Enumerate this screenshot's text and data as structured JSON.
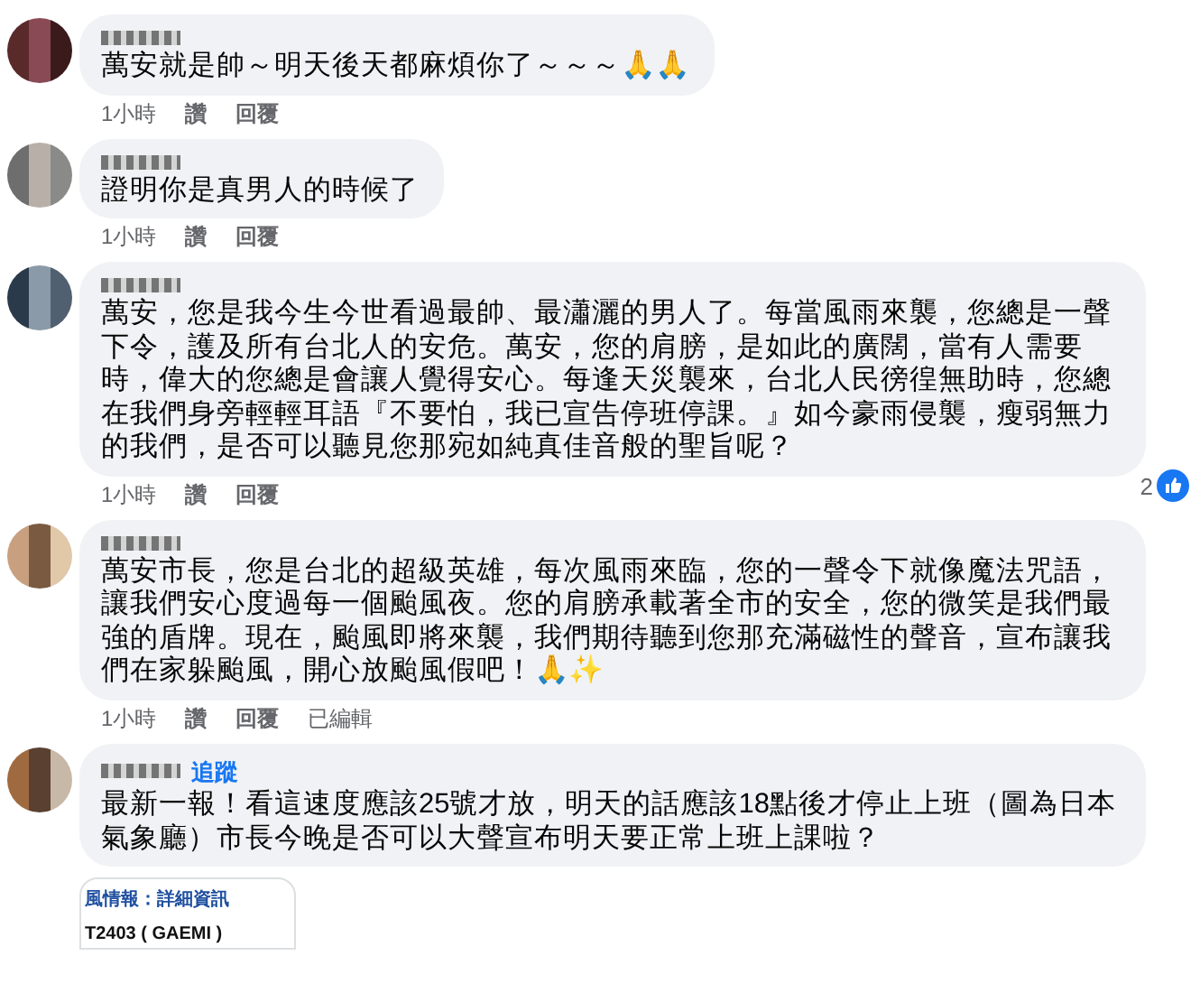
{
  "comments": [
    {
      "text": "萬安就是帥～明天後天都麻煩你了～～～🙏🙏",
      "actions": [
        {
          "label": "1小時",
          "kind": "time"
        },
        {
          "label": "讚",
          "kind": "link"
        },
        {
          "label": "回覆",
          "kind": "link"
        }
      ]
    },
    {
      "text": "證明你是真男人的時候了",
      "actions": [
        {
          "label": "1小時",
          "kind": "time"
        },
        {
          "label": "讚",
          "kind": "link"
        },
        {
          "label": "回覆",
          "kind": "link"
        }
      ]
    },
    {
      "text": "萬安，您是我今生今世看過最帥、最瀟灑的男人了。每當風雨來襲，您總是一聲下令，護及所有台北人的安危。萬安，您的肩膀，是如此的廣闊，當有人需要時，偉大的您總是會讓人覺得安心。每逢天災襲來，台北人民徬徨無助時，您總在我們身旁輕輕耳語『不要怕，我已宣告停班停課。』如今豪雨侵襲，瘦弱無力的我們，是否可以聽見您那宛如純真佳音般的聖旨呢？",
      "actions": [
        {
          "label": "1小時",
          "kind": "time"
        },
        {
          "label": "讚",
          "kind": "link"
        },
        {
          "label": "回覆",
          "kind": "link"
        }
      ],
      "reaction_count": "2"
    },
    {
      "text": "萬安市長，您是台北的超級英雄，每次風雨來臨，您的一聲令下就像魔法咒語，讓我們安心度過每一個颱風夜。您的肩膀承載著全市的安全，您的微笑是我們最強的盾牌。現在，颱風即將來襲，我們期待聽到您那充滿磁性的聲音，宣布讓我們在家躲颱風，開心放颱風假吧！🙏✨",
      "actions": [
        {
          "label": "1小時",
          "kind": "time"
        },
        {
          "label": "讚",
          "kind": "link"
        },
        {
          "label": "回覆",
          "kind": "link"
        },
        {
          "label": "已編輯",
          "kind": "note"
        }
      ]
    },
    {
      "text": "最新一報！看這速度應該25號才放，明天的話應該18點後才停止上班（圖為日本氣象廳）市長今晚是否可以大聲宣布明天要正常上班上課啦？",
      "follow_link": "追蹤"
    }
  ],
  "attachment": {
    "title": "風情報：詳細資訊",
    "subtitle": "T2403 ( GAEMI )"
  }
}
